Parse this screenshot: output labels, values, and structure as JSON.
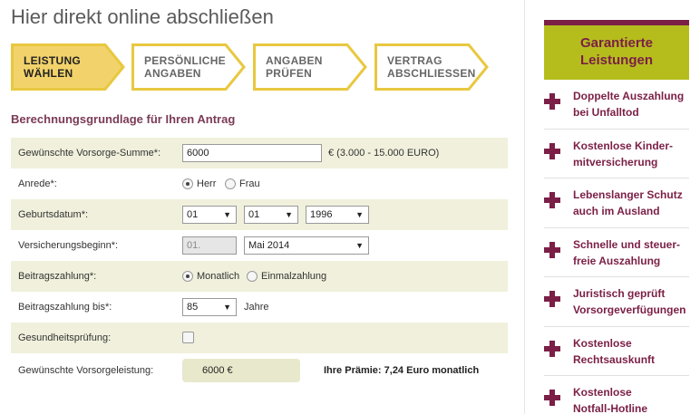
{
  "page": {
    "title": "Hier direkt online abschließen"
  },
  "steps": [
    {
      "label": "LEISTUNG\nWÄHLEN",
      "active": true
    },
    {
      "label": "PERSÖNLICHE\nANGABEN",
      "active": false
    },
    {
      "label": "ANGABEN\nPRÜFEN",
      "active": false
    },
    {
      "label": "VERTRAG\nABSCHLIESSEN",
      "active": false
    }
  ],
  "section": {
    "title": "Berechnungsgrundlage für Ihren Antrag"
  },
  "form": {
    "sum": {
      "label": "Gewünschte Vorsorge-Summe*:",
      "value": "6000",
      "hint": "€ (3.000 - 15.000 EURO)"
    },
    "salutation": {
      "label": "Anrede*:",
      "options": [
        "Herr",
        "Frau"
      ],
      "selected": "Herr"
    },
    "birthdate": {
      "label": "Geburtsdatum*:",
      "day": "01",
      "month": "01",
      "year": "1996"
    },
    "start": {
      "label": "Versicherungsbeginn*:",
      "day": "01.",
      "month": "Mai 2014"
    },
    "payment": {
      "label": "Beitragszahlung*:",
      "options": [
        "Monatlich",
        "Einmalzahlung"
      ],
      "selected": "Monatlich"
    },
    "payment_until": {
      "label": "Beitragszahlung bis*:",
      "value": "85",
      "unit": "Jahre"
    },
    "health": {
      "label": "Gesundheitsprüfung:",
      "checked": false
    },
    "result": {
      "label": "Gewünschte Vorsorgeleistung:",
      "value": "6000 €",
      "premium": "Ihre Prämie: 7,24 Euro monatlich"
    }
  },
  "sidebar": {
    "title": "Garantierte\nLeistungen",
    "benefits": [
      "Doppelte Auszahlung\nbei Unfalltod",
      "Kostenlose Kinder-\nmitversicherung",
      "Lebenslanger Schutz\nauch im Ausland",
      "Schnelle und steuer-\nfreie Auszahlung",
      "Juristisch geprüft\nVorsorgeverfügungen",
      "Kostenlose\nRechtsauskunft",
      "Kostenlose\nNotfall-Hotline"
    ]
  },
  "colors": {
    "accent_brand": "#7b1f46",
    "accent_lime": "#b5bd1d",
    "step_active_fill": "#f2d36b",
    "step_border": "#e8c840",
    "row_shade": "#f0f0dc"
  },
  "icons": {
    "plus": "plus-icon",
    "dropdown": "chevron-down-icon"
  }
}
